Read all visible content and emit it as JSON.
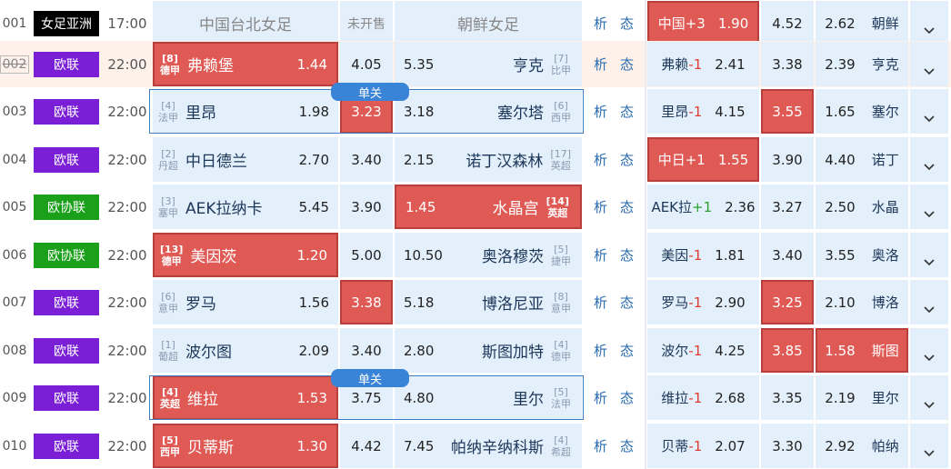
{
  "single_badge": "单关",
  "analysis_labels": [
    "析",
    "态"
  ],
  "colors": {
    "red": "#e05a55",
    "blue_cell": "#e3f0fc",
    "purple": "#7b1fd6",
    "green": "#1aa01a",
    "black": "#000000"
  },
  "rows": [
    {
      "num": "001",
      "league": "女足亚洲",
      "league_color": "#000000",
      "time": "17:00",
      "home": {
        "name": "中国台北女足",
        "rank": "",
        "rank2": ""
      },
      "draw": "未开售",
      "away": {
        "name": "朝鲜女足",
        "rank": "",
        "rank2": ""
      },
      "hc": {
        "name": "中国",
        "sign": "+3",
        "odd": "1.90"
      },
      "hc_draw": "4.52",
      "hc_away": {
        "odd": "2.62",
        "name": "朝鲜"
      }
    },
    {
      "num": "002",
      "league": "欧联",
      "league_color": "#7b1fd6",
      "time": "22:00",
      "home": {
        "name": "弗赖堡",
        "rank": "[8]",
        "rank2": "德甲",
        "odd": "1.44"
      },
      "draw": "4.05",
      "away": {
        "name": "亨克",
        "rank": "[7]",
        "rank2": "比甲",
        "odd": "5.35"
      },
      "hc": {
        "name": "弗赖",
        "sign": "-1",
        "odd": "2.41"
      },
      "hc_draw": "3.38",
      "hc_away": {
        "odd": "2.39",
        "name": "亨克"
      }
    },
    {
      "num": "003",
      "league": "欧联",
      "league_color": "#7b1fd6",
      "time": "22:00",
      "home": {
        "name": "里昂",
        "rank": "[4]",
        "rank2": "法甲",
        "odd": "1.98"
      },
      "draw": "3.23",
      "away": {
        "name": "塞尔塔",
        "rank": "[6]",
        "rank2": "西甲",
        "odd": "3.18"
      },
      "hc": {
        "name": "里昂",
        "sign": "-1",
        "odd": "4.15"
      },
      "hc_draw": "3.55",
      "hc_away": {
        "odd": "1.65",
        "name": "塞尔"
      }
    },
    {
      "num": "004",
      "league": "欧联",
      "league_color": "#7b1fd6",
      "time": "22:00",
      "home": {
        "name": "中日德兰",
        "rank": "[2]",
        "rank2": "丹超",
        "odd": "2.70"
      },
      "draw": "3.40",
      "away": {
        "name": "诺丁汉森林",
        "rank": "[17]",
        "rank2": "英超",
        "odd": "2.15"
      },
      "hc": {
        "name": "中日",
        "sign": "+1",
        "odd": "1.55"
      },
      "hc_draw": "3.90",
      "hc_away": {
        "odd": "4.40",
        "name": "诺丁"
      }
    },
    {
      "num": "005",
      "league": "欧协联",
      "league_color": "#1aa01a",
      "time": "22:00",
      "home": {
        "name": "AEK拉纳卡",
        "rank": "[3]",
        "rank2": "塞甲",
        "odd": "5.45"
      },
      "draw": "3.90",
      "away": {
        "name": "水晶宫",
        "rank": "[14]",
        "rank2": "英超",
        "odd": "1.45"
      },
      "hc": {
        "name": "AEK拉",
        "sign": "+1",
        "odd": "2.36"
      },
      "hc_draw": "3.27",
      "hc_away": {
        "odd": "2.50",
        "name": "水晶"
      }
    },
    {
      "num": "006",
      "league": "欧协联",
      "league_color": "#1aa01a",
      "time": "22:00",
      "home": {
        "name": "美因茨",
        "rank": "[13]",
        "rank2": "德甲",
        "odd": "1.20"
      },
      "draw": "5.00",
      "away": {
        "name": "奥洛穆茨",
        "rank": "[5]",
        "rank2": "捷甲",
        "odd": "10.50"
      },
      "hc": {
        "name": "美因",
        "sign": "-1",
        "odd": "1.81"
      },
      "hc_draw": "3.40",
      "hc_away": {
        "odd": "3.55",
        "name": "奥洛"
      }
    },
    {
      "num": "007",
      "league": "欧联",
      "league_color": "#7b1fd6",
      "time": "22:00",
      "home": {
        "name": "罗马",
        "rank": "[6]",
        "rank2": "意甲",
        "odd": "1.56"
      },
      "draw": "3.38",
      "away": {
        "name": "博洛尼亚",
        "rank": "[8]",
        "rank2": "意甲",
        "odd": "5.18"
      },
      "hc": {
        "name": "罗马",
        "sign": "-1",
        "odd": "2.90"
      },
      "hc_draw": "3.25",
      "hc_away": {
        "odd": "2.10",
        "name": "博洛"
      }
    },
    {
      "num": "008",
      "league": "欧联",
      "league_color": "#7b1fd6",
      "time": "22:00",
      "home": {
        "name": "波尔图",
        "rank": "[1]",
        "rank2": "葡超",
        "odd": "2.09"
      },
      "draw": "3.40",
      "away": {
        "name": "斯图加特",
        "rank": "[4]",
        "rank2": "德甲",
        "odd": "2.80"
      },
      "hc": {
        "name": "波尔",
        "sign": "-1",
        "odd": "4.25"
      },
      "hc_draw": "3.85",
      "hc_away": {
        "odd": "1.58",
        "name": "斯图"
      }
    },
    {
      "num": "009",
      "league": "欧联",
      "league_color": "#7b1fd6",
      "time": "22:00",
      "home": {
        "name": "维拉",
        "rank": "[4]",
        "rank2": "英超",
        "odd": "1.53"
      },
      "draw": "3.75",
      "away": {
        "name": "里尔",
        "rank": "[5]",
        "rank2": "法甲",
        "odd": "4.80"
      },
      "hc": {
        "name": "维拉",
        "sign": "-1",
        "odd": "2.68"
      },
      "hc_draw": "3.35",
      "hc_away": {
        "odd": "2.19",
        "name": "里尔"
      }
    },
    {
      "num": "010",
      "league": "欧联",
      "league_color": "#7b1fd6",
      "time": "22:00",
      "home": {
        "name": "贝蒂斯",
        "rank": "[5]",
        "rank2": "西甲",
        "odd": "1.30"
      },
      "draw": "4.42",
      "away": {
        "name": "帕纳辛纳科斯",
        "rank": "[4]",
        "rank2": "希超",
        "odd": "7.45"
      },
      "hc": {
        "name": "贝蒂",
        "sign": "-1",
        "odd": "2.07"
      },
      "hc_draw": "3.30",
      "hc_away": {
        "odd": "2.92",
        "name": "帕纳"
      }
    }
  ]
}
